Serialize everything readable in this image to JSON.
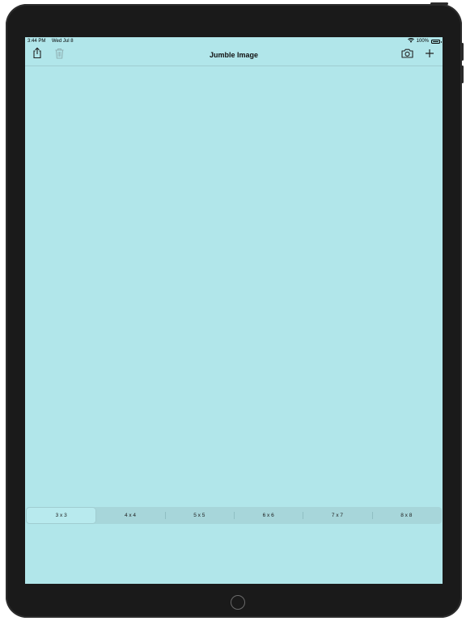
{
  "status_bar": {
    "time": "3:44 PM",
    "date": "Wed Jul 8",
    "battery": "100%",
    "icons": [
      "wifi-icon",
      "battery-icon"
    ]
  },
  "nav": {
    "title": "Jumble Image",
    "left_icons": [
      "share-icon",
      "trash-icon"
    ],
    "right_icons": [
      "camera-icon",
      "plus-icon"
    ]
  },
  "grid_sizes": {
    "options": [
      "3 x 3",
      "4 x 4",
      "5 x 5",
      "6 x 6",
      "7 x 7",
      "8 x 8"
    ],
    "selected": "3 x 3"
  },
  "colors": {
    "screen_background": "#b1e6ea",
    "device_frame": "#1a1a1a",
    "segment_background": "#a7d6da"
  }
}
